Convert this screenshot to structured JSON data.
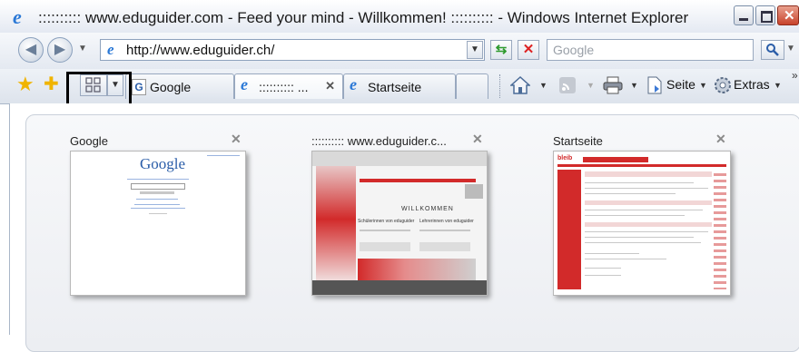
{
  "window": {
    "title": ":::::::::: www.eduguider.com - Feed your mind - Willkommen! :::::::::: - Windows Internet Explorer"
  },
  "address_bar": {
    "url": "http://www.eduguider.ch/",
    "search_placeholder": "Google"
  },
  "tabs": [
    {
      "label": "Google"
    },
    {
      "label": ":::::::::: ..."
    },
    {
      "label": "Startseite"
    }
  ],
  "toolbar": {
    "page_label": "Seite",
    "tools_label": "Extras"
  },
  "quick_tabs": [
    {
      "title": "Google",
      "logo_text": "Google"
    },
    {
      "title": ":::::::::: www.eduguider.c...",
      "willkommen": "WILLKOMMEN",
      "left_heading": "Schülerinnen von eduguider",
      "right_heading": "Lehrerinnen von eduguider"
    },
    {
      "title": "Startseite",
      "logo_text": "bleib"
    }
  ],
  "icons": {
    "browser": "ie-icon",
    "back": "back-arrow-icon",
    "forward": "forward-arrow-icon",
    "refresh": "refresh-icon",
    "stop": "stop-icon",
    "search": "magnifier-icon",
    "favorites": "star-icon",
    "add_favorite": "add-favorite-icon",
    "quick_tabs": "quick-tabs-grid-icon",
    "home": "home-icon",
    "feeds": "rss-icon",
    "print": "printer-icon",
    "page": "page-icon",
    "tools": "gear-icon"
  },
  "colors": {
    "ie_blue": "#2a78d6",
    "eduguider_red": "#d22a2a",
    "close_red": "#c8432b"
  }
}
